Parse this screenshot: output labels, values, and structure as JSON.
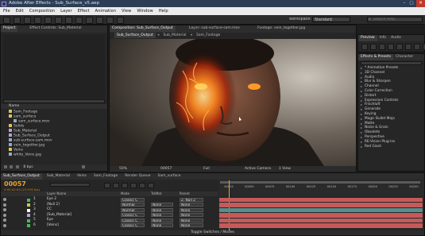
{
  "window": {
    "title": "Adobe After Effects - Sub_Surface_v5.aep",
    "controls": [
      "–",
      "▢",
      "✕"
    ]
  },
  "menu": [
    "File",
    "Edit",
    "Composition",
    "Layer",
    "Effect",
    "Animation",
    "View",
    "Window",
    "Help"
  ],
  "toolbar": {
    "workspace_label": "Workspace:",
    "workspace_value": "Standard",
    "search_placeholder": "Search Help"
  },
  "project_panel": {
    "tabs": [
      "Project",
      "Effect Controls: Sub_Material"
    ],
    "header_name": "Name",
    "items": [
      {
        "name": "Sam_Footage",
        "color": "#d9c55c"
      },
      {
        "name": "sam_surface",
        "color": "#d9c55c"
      },
      {
        "name": "sam_surface.mov",
        "color": "#8ab0c9"
      },
      {
        "name": "Solids",
        "color": "#d9c55c"
      },
      {
        "name": "Sub_Material",
        "color": "#b9a0d8"
      },
      {
        "name": "Sub_Surface_Output",
        "color": "#b9a0d8"
      },
      {
        "name": "sub-surface-sam.mov",
        "color": "#8ab0c9"
      },
      {
        "name": "vein_together.jpg",
        "color": "#8ab0c9"
      },
      {
        "name": "Veins",
        "color": "#d9c55c"
      },
      {
        "name": "white_Veins.jpg",
        "color": "#8ab0c9"
      }
    ],
    "footer": "8 bpc"
  },
  "comp_panel": {
    "tabs": [
      "Composition: Sub_Surface_Output",
      "Layer: sub-surface-sam.mov",
      "Footage: vein_together.jpg"
    ],
    "breadcrumbs": [
      "Sub_Surface_Output",
      "Sub_Material",
      "Sam_Footage"
    ],
    "footer": {
      "zoom": "50%",
      "timecode": "00057",
      "resolution": "Full",
      "camera": "Active Camera",
      "views": "1 View"
    }
  },
  "preview_panel": {
    "tabs": [
      "Preview",
      "Info",
      "Audio"
    ]
  },
  "effects_panel": {
    "tabs": [
      "Effects & Presets",
      "Character"
    ],
    "items": [
      "* Animation Presets",
      "3D Channel",
      "Audio",
      "Blur & Sharpen",
      "Channel",
      "Color Correction",
      "Distort",
      "Expression Controls",
      "Frischluft",
      "Generate",
      "Keying",
      "Magic Bullet Mojo",
      "Matte",
      "Noise & Grain",
      "Obsolete",
      "Perspective",
      "RE:Vision Plug-ins",
      "Red Giant"
    ]
  },
  "timeline": {
    "tabs": [
      "Sub_Surface_Output",
      "Sub_Material",
      "Veins",
      "Sam_Footage",
      "Render Queue",
      "Sam_surface"
    ],
    "current_time": "00057",
    "timecode_sub": "0:00:02:09 (23.976 fps)",
    "header": {
      "name": "Layer Name",
      "mode": "Mode",
      "trkmat": "TrkMat",
      "parent": "Parent"
    },
    "ruler": [
      "00025",
      "00050",
      "00075",
      "00100",
      "00125",
      "00150",
      "00175",
      "00200",
      "00225",
      "00250"
    ],
    "layers": [
      {
        "index": "1",
        "name": "Eye 2",
        "label_color": "#3fbf58",
        "mode": "Classic C",
        "trkmat": "",
        "parent": "2. Null 2",
        "bar_color": "#c55a5a"
      },
      {
        "index": "2",
        "name": "[Null 2]",
        "label_color": "#c8c84a",
        "mode": "Normal",
        "trkmat": "None",
        "parent": "None",
        "bar_color": "#c55a5a"
      },
      {
        "index": "3",
        "name": "CC",
        "label_color": "#ffffff",
        "mode": "Normal",
        "trkmat": "None",
        "parent": "None",
        "bar_color": "#5d8b8b"
      },
      {
        "index": "4",
        "name": "[Sub_Material]",
        "label_color": "#b9a0d8",
        "mode": "Classic C",
        "trkmat": "None",
        "parent": "None",
        "bar_color": "#c55a5a"
      },
      {
        "index": "5",
        "name": "Eye",
        "label_color": "#3fbf58",
        "mode": "Classic C",
        "trkmat": "None",
        "parent": "None",
        "bar_color": "#c55a5a"
      },
      {
        "index": "6",
        "name": "[Veins]",
        "label_color": "#3fbf58",
        "mode": "Classic C",
        "trkmat": "None",
        "parent": "None",
        "bar_color": "#c55a5a"
      }
    ],
    "footer": "Toggle Switches / Modes"
  }
}
